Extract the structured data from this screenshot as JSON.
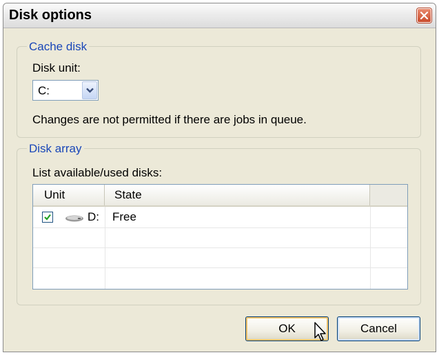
{
  "window": {
    "title": "Disk options"
  },
  "cache_group": {
    "legend": "Cache disk",
    "disk_unit_label": "Disk unit:",
    "disk_unit_value": "C:",
    "note": "Changes are not permitted if there are jobs in queue."
  },
  "array_group": {
    "legend": "Disk array",
    "list_label": "List available/used disks:",
    "columns": [
      "Unit",
      "State"
    ],
    "rows": [
      {
        "checked": true,
        "unit": "D:",
        "state": "Free"
      }
    ]
  },
  "buttons": {
    "ok": "OK",
    "cancel": "Cancel"
  },
  "icons": {
    "close": "close-icon",
    "dropdown": "chevron-down-icon",
    "drive": "hard-drive-icon",
    "check": "checkmark-icon",
    "cursor": "mouse-pointer-icon"
  }
}
